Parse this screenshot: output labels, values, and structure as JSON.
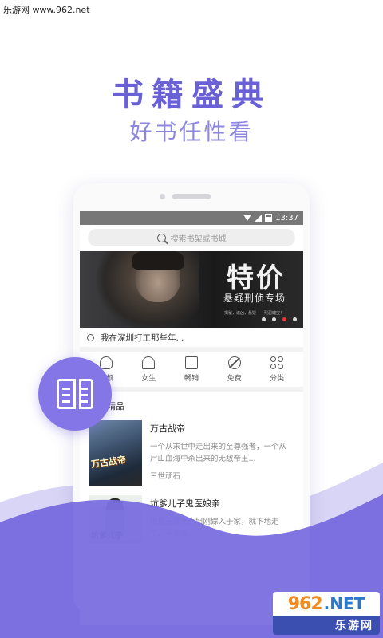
{
  "watermark": {
    "top_text": "乐游网 www.962.net",
    "bottom_number": "962",
    "bottom_net": ".NET",
    "bottom_label": "乐游网"
  },
  "hero": {
    "title": "书籍盛典",
    "subtitle": "好书任性看"
  },
  "colors": {
    "accent": "#6a61d6",
    "accent_light": "#8d87df",
    "badge": "#8476e6",
    "wave": "#7c6fe0",
    "dot_active": "#e23a3a"
  },
  "status_bar": {
    "time": "13:37"
  },
  "search": {
    "placeholder": "搜索书架或书城"
  },
  "banner": {
    "title": "特价",
    "subtitle": "悬疑刑侦专场",
    "small_text": "揭秘，追凶，悬疑——残忍瑰宝！"
  },
  "notice": {
    "text": "我在深圳打工那些年..."
  },
  "categories": [
    {
      "label": "男频",
      "icon": "male-icon"
    },
    {
      "label": "女生",
      "icon": "female-icon"
    },
    {
      "label": "畅销",
      "icon": "book-icon"
    },
    {
      "label": "免费",
      "icon": "free-icon"
    },
    {
      "label": "分类",
      "icon": "grid-icon"
    }
  ],
  "section": {
    "title": "主打精品"
  },
  "books": [
    {
      "title": "万古战帝",
      "description": "一个从末世中走出来的至尊强者，一个从尸山血海中杀出来的无敌帝王...",
      "author": "三世顽石",
      "cover_text": "万古战帝"
    },
    {
      "title": "坑爹儿子鬼医娘亲",
      "description": "听说玉家大小姐刚嫁入于家，就下地走了，半年后，",
      "author": "",
      "cover_text": "坑爹儿子"
    }
  ]
}
